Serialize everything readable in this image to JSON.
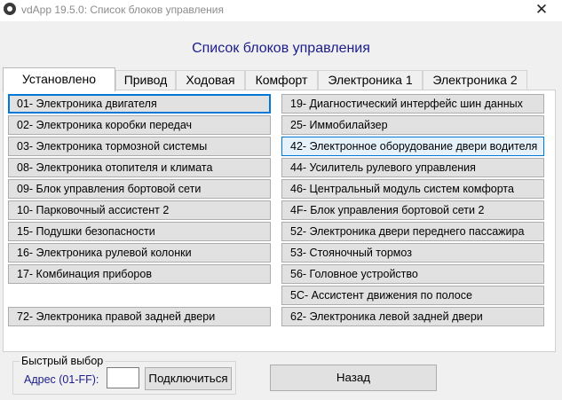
{
  "window": {
    "title": "vdApp 19.5.0:  Список блоков управления",
    "close_glyph": "✕"
  },
  "header": {
    "title": "Список блоков управления"
  },
  "tabs": [
    {
      "label": "Установлено",
      "active": true
    },
    {
      "label": "Привод"
    },
    {
      "label": "Ходовая"
    },
    {
      "label": "Комфорт"
    },
    {
      "label": "Электроника 1"
    },
    {
      "label": "Электроника 2"
    }
  ],
  "left_column": [
    "01- Электроника двигателя",
    "02- Электроника коробки передач",
    "03- Электроника тормозной системы",
    "08- Электроника отопителя и климата",
    "09- Блок управления бортовой сети",
    "10- Парковочный ассистент 2",
    "15- Подушки безопасности",
    "16- Электроника рулевой колонки",
    "17- Комбинация приборов",
    "72- Электроника правой задней двери"
  ],
  "right_column": [
    "19- Диагностический интерфейс шин данных",
    "25- Иммобилайзер",
    "42- Электронное оборудование двери водителя",
    "44- Усилитель рулевого управления",
    "46- Центральный модуль систем комфорта",
    "4F- Блок управления бортовой сети 2",
    "52- Электроника двери переднего пассажира",
    "53- Стояночный тормоз",
    "56- Головное устройство",
    "5C- Ассистент движения по полосе",
    "62- Электроника левой задней двери"
  ],
  "quick_select": {
    "legend": "Быстрый выбор",
    "address_label": "Адрес (01-FF):",
    "address_value": "",
    "connect_label": "Подключиться"
  },
  "footer": {
    "back_label": "Назад"
  },
  "colors": {
    "accent": "#0078d7",
    "header_text": "#1c1c8c",
    "button_face": "#e1e1e1"
  }
}
